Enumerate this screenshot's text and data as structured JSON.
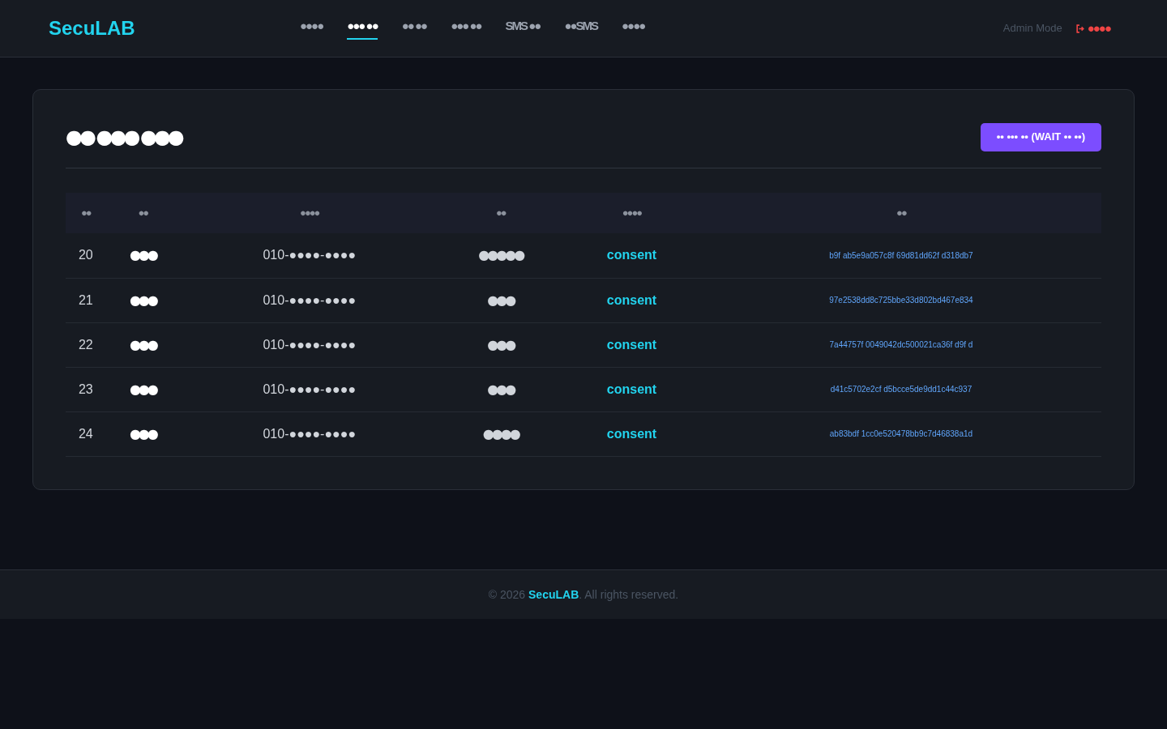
{
  "header": {
    "logo": "SecuLAB",
    "nav": [
      {
        "label": "●●●●",
        "selected": false
      },
      {
        "label": "●●● ●●",
        "selected": true
      },
      {
        "label": "●● ●●",
        "selected": false
      },
      {
        "label": "●●● ●●",
        "selected": false
      },
      {
        "label": "SMS ●●",
        "selected": false
      },
      {
        "label": "●●SMS",
        "selected": false
      },
      {
        "label": "●●●●",
        "selected": false
      }
    ],
    "mode": "Admin Mode",
    "logout": "●●●●"
  },
  "card": {
    "title": "●● ●●● ●●●",
    "action": "•• ••• •• (WAIT •• ••)",
    "table": {
      "columns": [
        "●●",
        "●●",
        "●●●●",
        "●●",
        "●●●●",
        "●●"
      ],
      "rows": [
        [
          "20",
          "●●●",
          "010-●●●●-●●●●",
          "●●●●●",
          "consent",
          "b9f ab5e9a057c8f 69d81dd62f d318db7"
        ],
        [
          "21",
          "●●●",
          "010-●●●●-●●●●",
          "●●●",
          "consent",
          "97e2538dd8c725bbe33d802bd467e834"
        ],
        [
          "22",
          "●●●",
          "010-●●●●-●●●●",
          "●●●",
          "consent",
          "7a44757f 0049042dc500021ca36f d9f d"
        ],
        [
          "23",
          "●●●",
          "010-●●●●-●●●●",
          "●●●",
          "consent",
          "d41c5702e2cf d5bcce5de9dd1c44c937"
        ],
        [
          "24",
          "●●●",
          "010-●●●●-●●●●",
          "●●●●",
          "consent",
          "ab83bdf 1cc0e520478bb9c7d46838a1d"
        ]
      ]
    }
  },
  "footer": {
    "copyright": "© 2026",
    "brand": "SecuLAB",
    "rest": ". All rights reserved."
  }
}
